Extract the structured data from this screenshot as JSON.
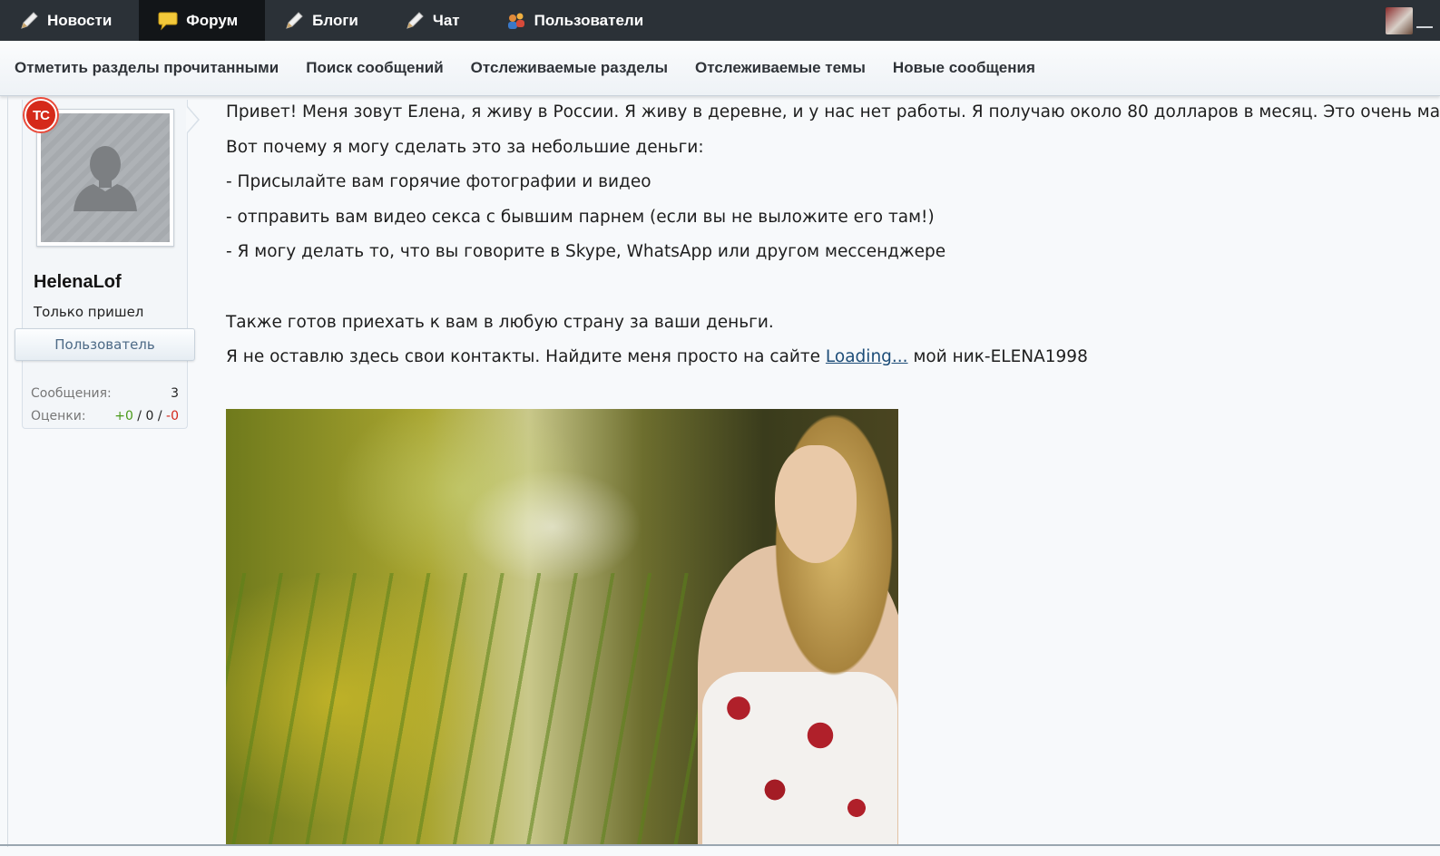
{
  "topnav": {
    "tabs": [
      {
        "label": "Новости",
        "icon": "pen-icon",
        "active": false
      },
      {
        "label": "Форум",
        "icon": "speech-bubble-icon",
        "active": true
      },
      {
        "label": "Блоги",
        "icon": "pen-icon",
        "active": false
      },
      {
        "label": "Чат",
        "icon": "pen-icon",
        "active": false
      },
      {
        "label": "Пользователи",
        "icon": "users-icon",
        "active": false
      }
    ]
  },
  "subnav": {
    "links": [
      "Отметить разделы прочитанными",
      "Поиск сообщений",
      "Отслеживаемые разделы",
      "Отслеживаемые темы",
      "Новые сообщения"
    ]
  },
  "user": {
    "badge": "TC",
    "name": "HelenaLof",
    "title": "Только пришел",
    "role": "Пользователь",
    "stats": {
      "messages_label": "Сообщения:",
      "messages_value": "3",
      "ratings_label": "Оценки:",
      "ratings_pos": "+0",
      "ratings_sep1": " / ",
      "ratings_neutral": "0",
      "ratings_sep2": " / ",
      "ratings_neg": "-0"
    }
  },
  "message": {
    "lines": [
      "Привет! Меня зовут Елена, я живу в России. Я живу в деревне, и у нас нет работы. Я получаю около 80 долларов в месяц. Это очень мало ((",
      "Вот почему я могу сделать это за небольшие деньги:",
      "- Присылайте вам горячие фотографии и видео",
      "- отправить вам видео секса с бывшим парнем (если вы не выложите его там!)",
      "- Я могу делать то, что вы говорите в Skype, WhatsApp или другом мессенджере",
      "",
      "Также готов приехать к вам в любую страну за ваши деньги."
    ],
    "last_line_before": "Я не оставлю здесь свои контакты. Найдите меня просто на сайте ",
    "link_text": "Loading...",
    "last_line_after": " мой ник-ELENA1998"
  },
  "colors": {
    "topnav_bg": "#2b3137",
    "active_tab_bg": "#121518",
    "link": "#1d4d78",
    "positive": "#4a9a1a",
    "negative": "#d3271a"
  }
}
